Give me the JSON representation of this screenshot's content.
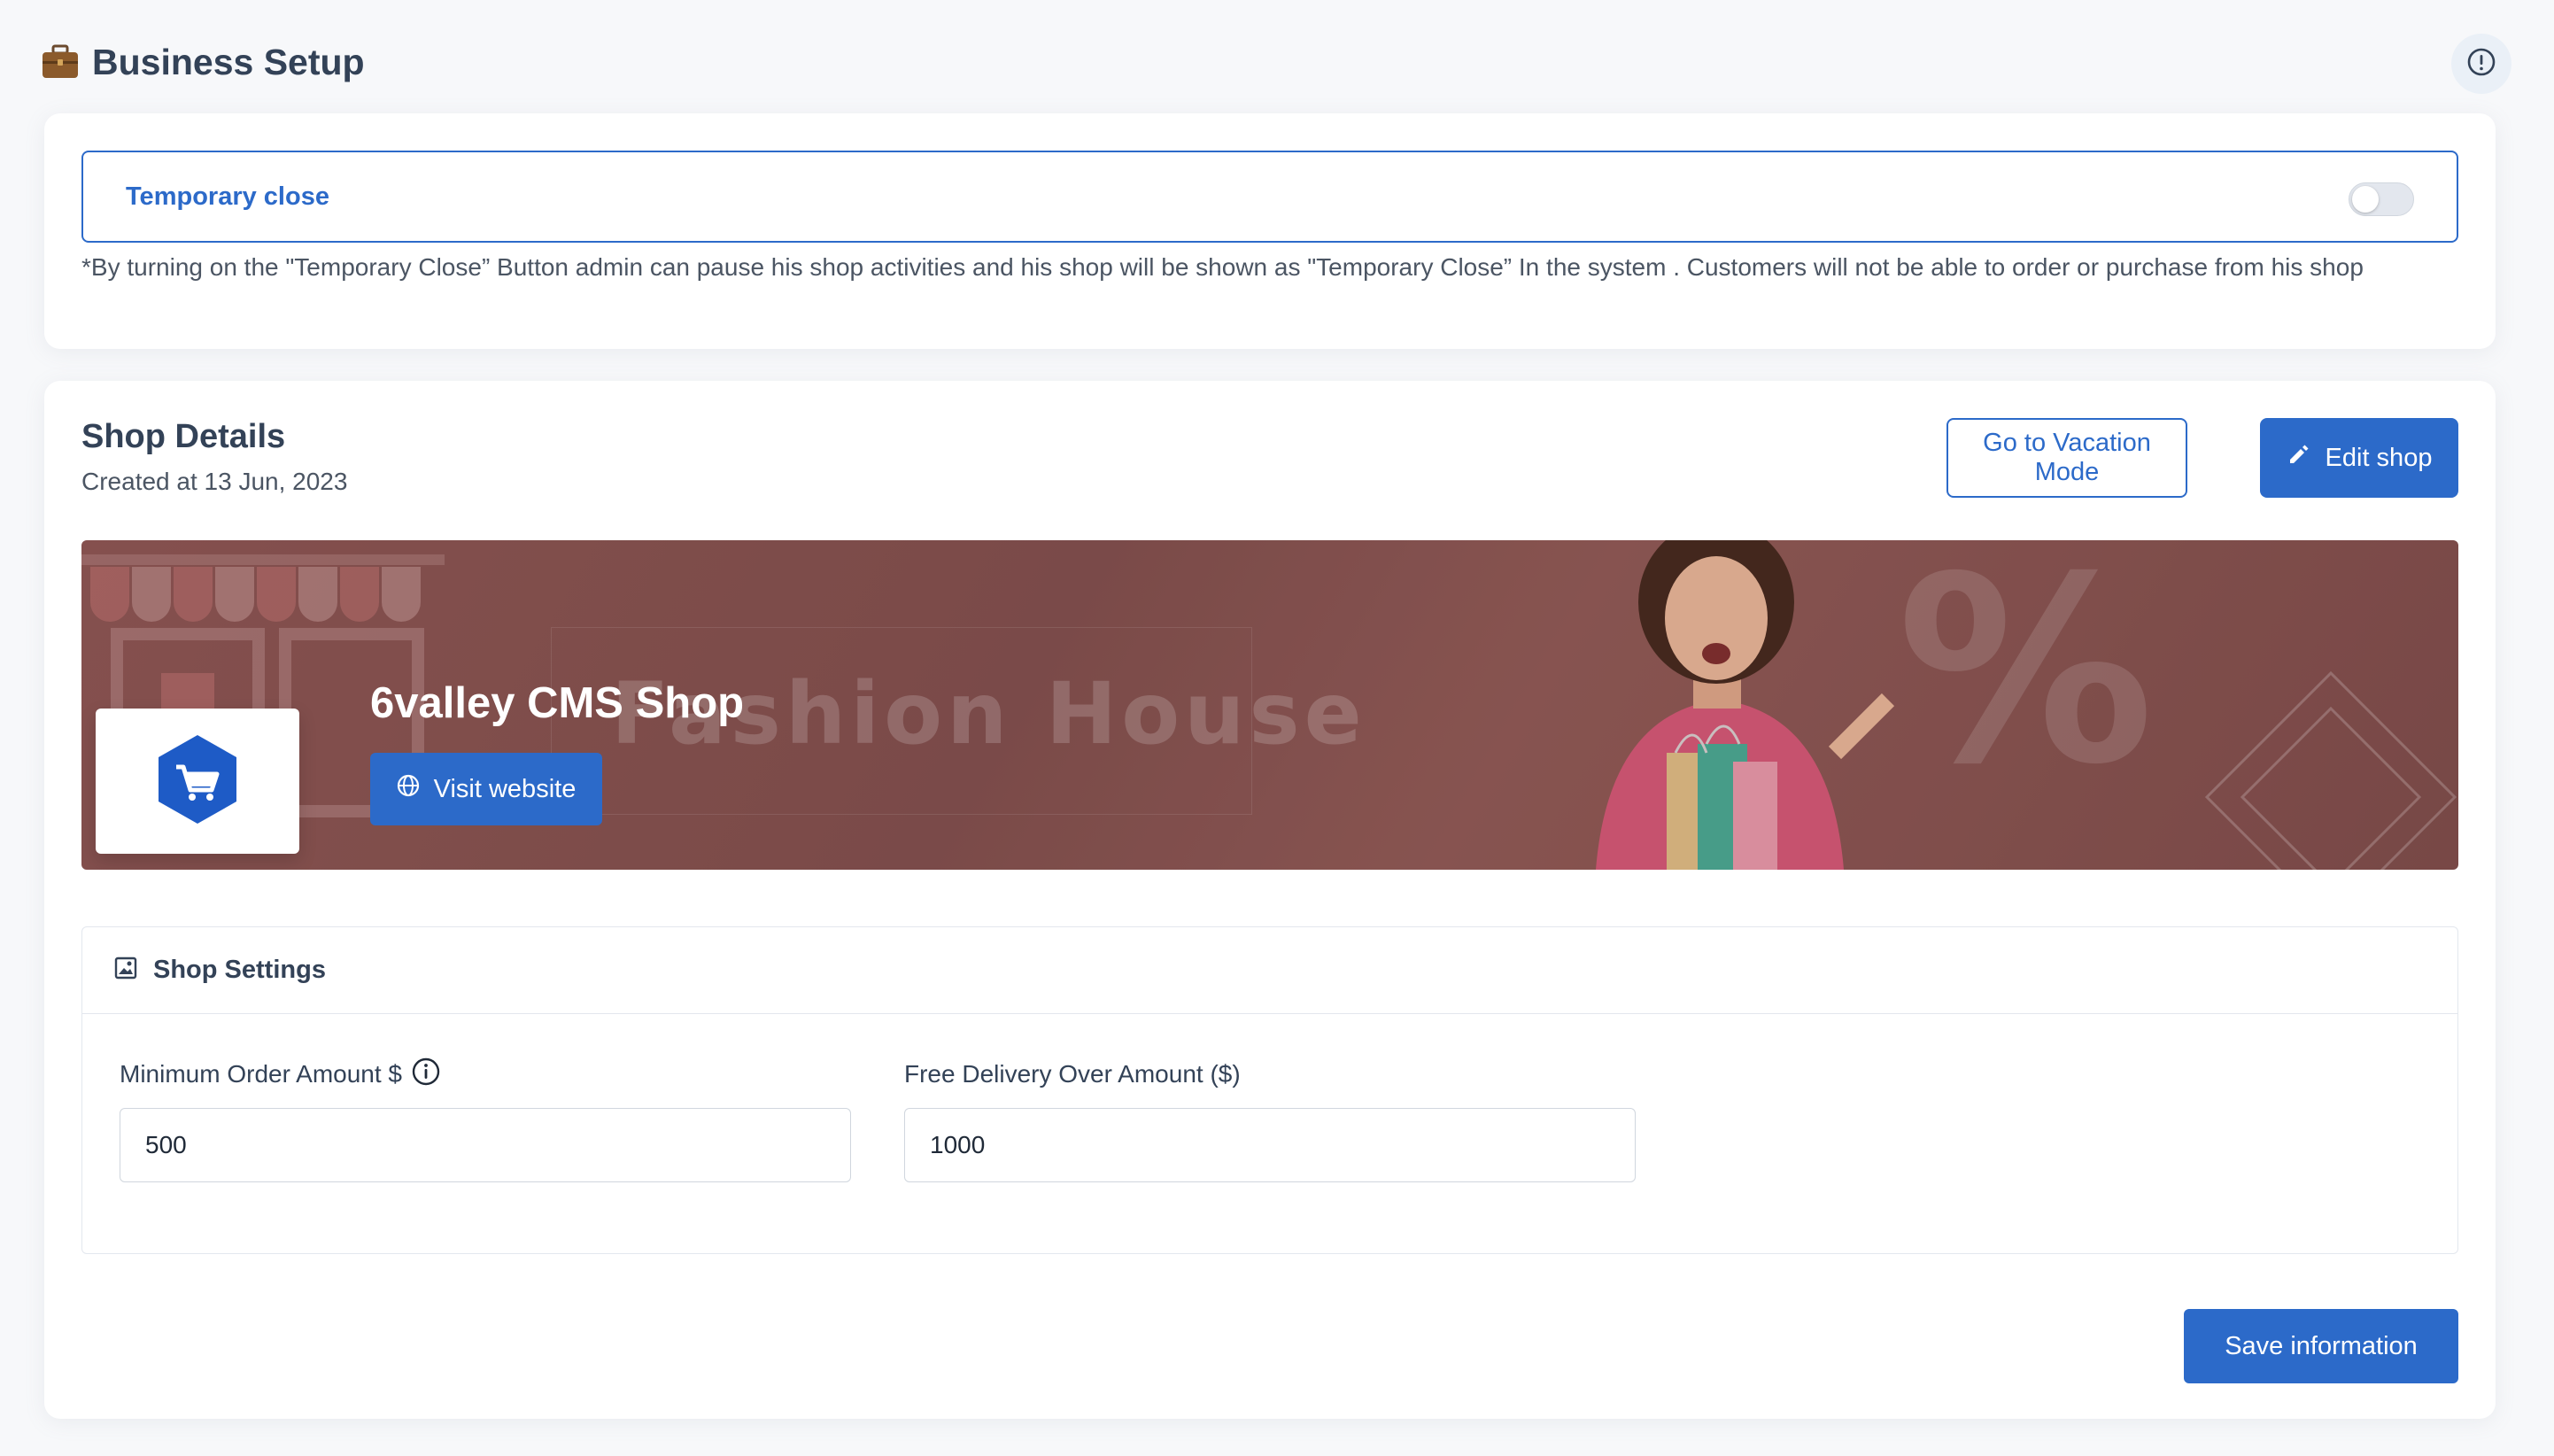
{
  "header": {
    "title": "Business Setup",
    "title_icon": "briefcase-icon",
    "info_icon": "info-circle-icon"
  },
  "temporary_close": {
    "label": "Temporary close",
    "enabled": false,
    "note": "*By turning on the \"Temporary Close” Button admin can pause his shop activities and his shop will be shown as \"Temporary Close” In the system . Customers will not be able to order or purchase from his shop"
  },
  "shop_details": {
    "title": "Shop Details",
    "created": "Created at 13 Jun, 2023",
    "vacation_button": "Go to Vacation Mode",
    "edit_button": "Edit shop",
    "edit_icon": "pencil-icon"
  },
  "banner": {
    "background_text": "Fashion House",
    "percent_text": "%",
    "shop_name": "6valley CMS Shop",
    "visit_button": "Visit website",
    "visit_icon": "globe-icon",
    "logo_icon": "cart-hexagon-icon"
  },
  "shop_settings": {
    "title": "Shop Settings",
    "icon": "image-icon",
    "min_order_label": "Minimum Order Amount $",
    "min_order_value": "500",
    "free_delivery_label": "Free Delivery Over Amount ($)",
    "free_delivery_value": "1000"
  },
  "save_button": "Save information",
  "colors": {
    "primary": "#2c6ac9",
    "text_dark": "#334257",
    "banner": "#8a5653"
  }
}
